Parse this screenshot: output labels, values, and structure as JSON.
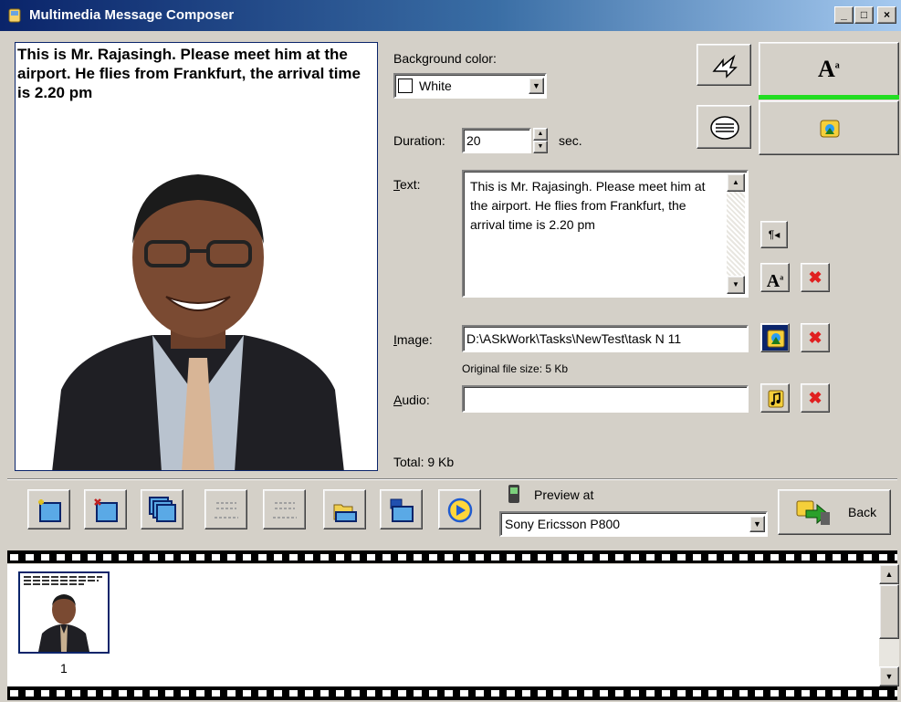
{
  "window": {
    "title": "Multimedia Message Composer",
    "minimize": "_",
    "maximize": "□",
    "close": "×"
  },
  "slide": {
    "text": "This is Mr. Rajasingh. Please meet him at the airport. He flies from Frankfurt, the arrival time is 2.20 pm"
  },
  "settings": {
    "background_color_label": "Background color:",
    "background_color_value": "White",
    "duration_label": "Duration:",
    "duration_value": "20",
    "duration_unit": "sec.",
    "text_label": "Text:",
    "text_value": "This is Mr. Rajasingh. Please meet him at the airport. He flies from Frankfurt, the arrival time is 2.20 pm",
    "image_label": "Image:",
    "image_path": "D:\\ASkWork\\Tasks\\NewTest\\task N 11",
    "original_file_size": "Original file size: 5 Kb",
    "audio_label": "Audio:",
    "audio_path": "",
    "total": "Total: 9 Kb"
  },
  "preview": {
    "label": "Preview at",
    "device": "Sony Ericsson P800"
  },
  "back_button": "Back",
  "thumbnails": [
    {
      "number": "1"
    }
  ],
  "colors": {
    "title_bar": "#0a246a",
    "accent_green": "#22dd22",
    "delete_red": "#e02020"
  }
}
